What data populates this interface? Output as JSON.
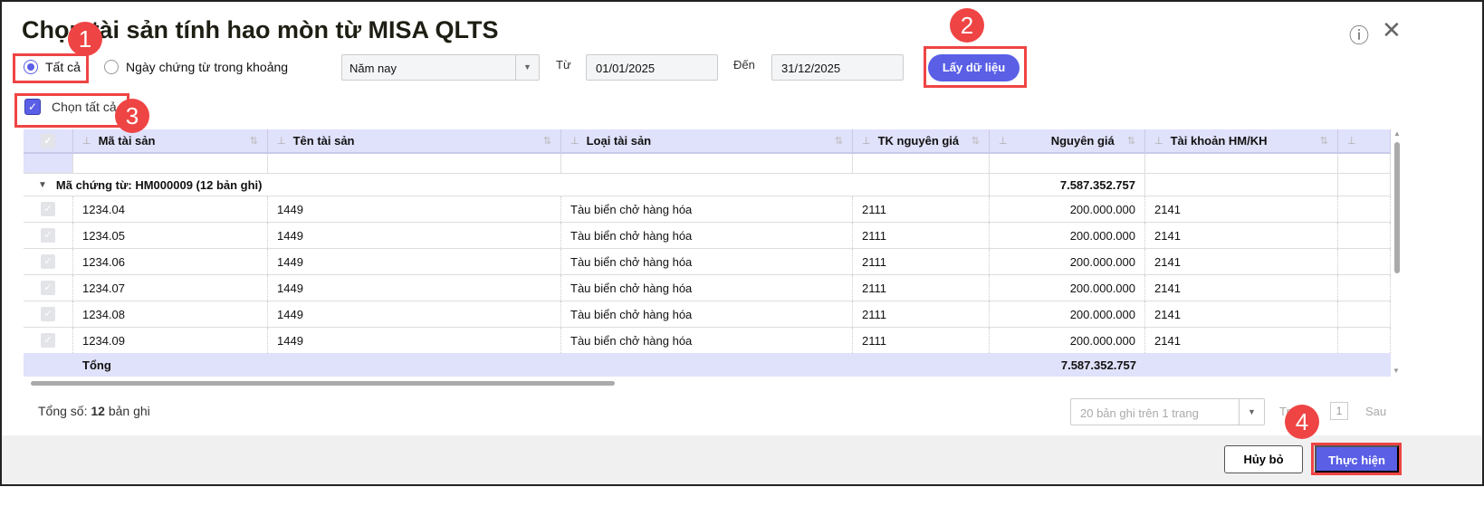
{
  "dialog": {
    "title": "Chọn tài sản tính hao mòn từ MISA QLTS",
    "help_icon": "help-circle-icon",
    "close_icon": "close-icon"
  },
  "filter": {
    "radio_all": "Tất cả",
    "radio_range": "Ngày chứng từ trong khoảng",
    "period": "Năm nay",
    "from_label": "Từ",
    "from_value": "01/01/2025",
    "to_label": "Đến",
    "to_value": "31/12/2025",
    "get_button": "Lấy dữ liệu"
  },
  "select_all": "Chọn tất cả",
  "table": {
    "headers": [
      "Mã tài sản",
      "Tên tài sản",
      "Loại tài sản",
      "TK nguyên giá",
      "Nguyên giá",
      "Tài khoản HM/KH",
      ""
    ],
    "group": {
      "label": "Mã chứng từ: HM000009 (12 bản ghi)",
      "total": "7.587.352.757"
    },
    "rows": [
      [
        "1234.04",
        "1449",
        "Tàu biển chở hàng hóa",
        "2111",
        "200.000.000",
        "2141"
      ],
      [
        "1234.05",
        "1449",
        "Tàu biển chở hàng hóa",
        "2111",
        "200.000.000",
        "2141"
      ],
      [
        "1234.06",
        "1449",
        "Tàu biển chở hàng hóa",
        "2111",
        "200.000.000",
        "2141"
      ],
      [
        "1234.07",
        "1449",
        "Tàu biển chở hàng hóa",
        "2111",
        "200.000.000",
        "2141"
      ],
      [
        "1234.08",
        "1449",
        "Tàu biển chở hàng hóa",
        "2111",
        "200.000.000",
        "2141"
      ],
      [
        "1234.09",
        "1449",
        "Tàu biển chở hàng hóa",
        "2111",
        "200.000.000",
        "2141"
      ]
    ],
    "total_label": "Tổng",
    "total_value": "7.587.352.757"
  },
  "footer": {
    "count_prefix": "Tổng số:",
    "count_value": "12",
    "count_suffix": "bản ghi",
    "page_size": "20 bản ghi trên 1 trang",
    "prev": "Trước",
    "page": "1",
    "next": "Sau",
    "cancel": "Hủy bỏ",
    "confirm": "Thực hiện"
  },
  "badges": [
    "1",
    "2",
    "3",
    "4"
  ],
  "colors": {
    "accent": "#5a5fe6",
    "highlight": "#ef4444",
    "header_bg": "#e0e1fa"
  }
}
